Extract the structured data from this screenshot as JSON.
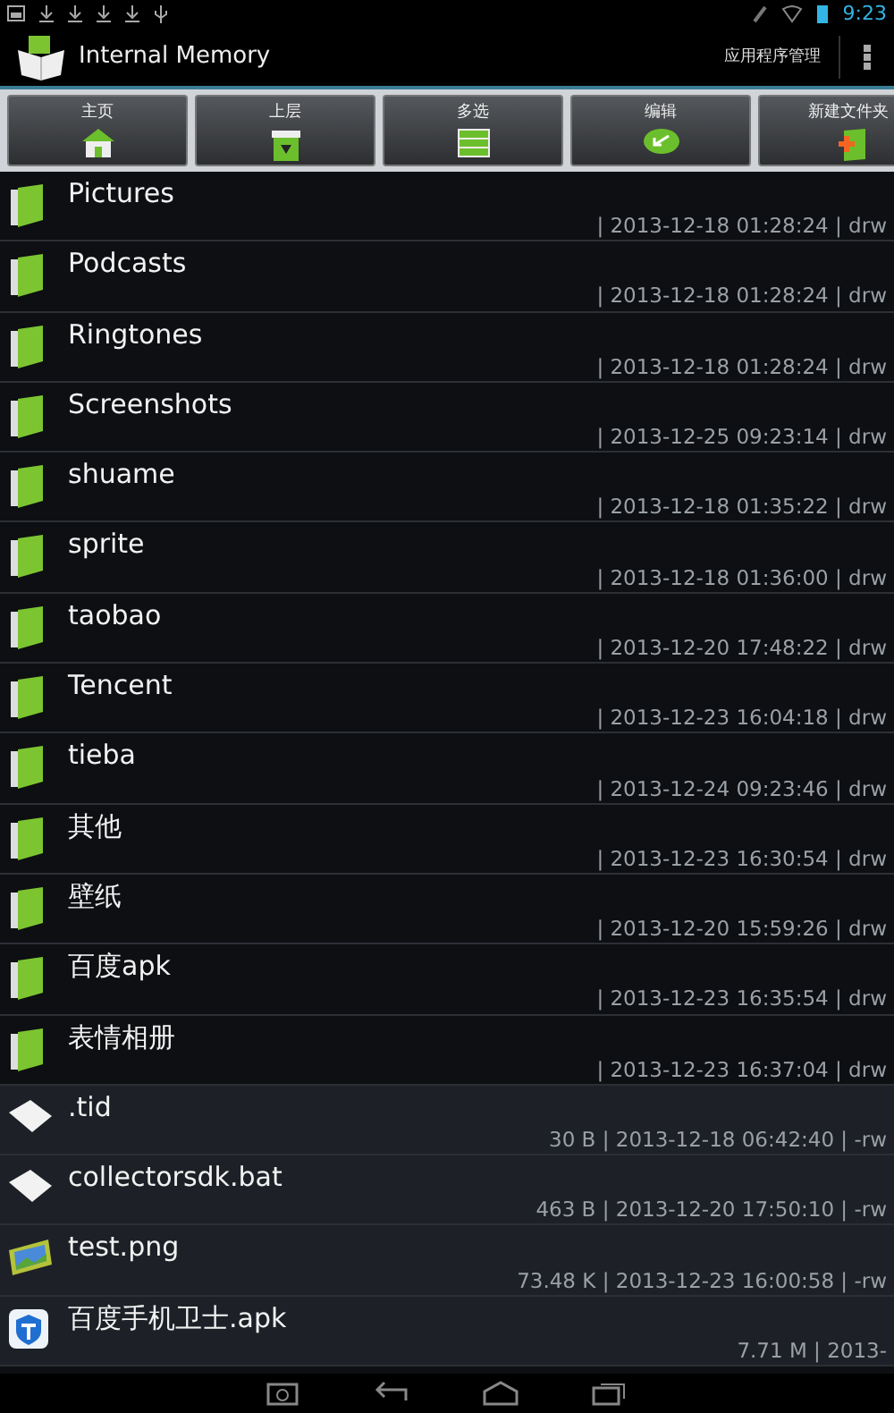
{
  "status_bar": {
    "time": "9:23"
  },
  "action_bar": {
    "title": "Internal Memory",
    "action": "应用程序管理"
  },
  "toolbar": [
    {
      "label": "主页",
      "kind": "home"
    },
    {
      "label": "上层",
      "kind": "up"
    },
    {
      "label": "多选",
      "kind": "multi"
    },
    {
      "label": "编辑",
      "kind": "edit"
    },
    {
      "label": "新建文件夹",
      "kind": "newfolder"
    }
  ],
  "files": [
    {
      "name": "Pictures",
      "meta": "| 2013-12-18 01:28:24 | drw",
      "kind": "folder"
    },
    {
      "name": "Podcasts",
      "meta": "| 2013-12-18 01:28:24 | drw",
      "kind": "folder"
    },
    {
      "name": "Ringtones",
      "meta": "| 2013-12-18 01:28:24 | drw",
      "kind": "folder"
    },
    {
      "name": "Screenshots",
      "meta": "| 2013-12-25 09:23:14 | drw",
      "kind": "folder"
    },
    {
      "name": "shuame",
      "meta": "| 2013-12-18 01:35:22 | drw",
      "kind": "folder"
    },
    {
      "name": "sprite",
      "meta": "| 2013-12-18 01:36:00 | drw",
      "kind": "folder"
    },
    {
      "name": "taobao",
      "meta": "| 2013-12-20 17:48:22 | drw",
      "kind": "folder"
    },
    {
      "name": "Tencent",
      "meta": "| 2013-12-23 16:04:18 | drw",
      "kind": "folder"
    },
    {
      "name": "tieba",
      "meta": "| 2013-12-24 09:23:46 | drw",
      "kind": "folder"
    },
    {
      "name": "其他",
      "meta": "| 2013-12-23 16:30:54 | drw",
      "kind": "folder"
    },
    {
      "name": "壁纸",
      "meta": "| 2013-12-20 15:59:26 | drw",
      "kind": "folder"
    },
    {
      "name": "百度apk",
      "meta": "| 2013-12-23 16:35:54 | drw",
      "kind": "folder"
    },
    {
      "name": "表情相册",
      "meta": "| 2013-12-23 16:37:04 | drw",
      "kind": "folder"
    },
    {
      "name": ".tid",
      "meta": "30 B | 2013-12-18 06:42:40 | -rw",
      "kind": "file"
    },
    {
      "name": "collectorsdk.bat",
      "meta": "463 B | 2013-12-20 17:50:10 | -rw",
      "kind": "file"
    },
    {
      "name": "test.png",
      "meta": "73.48 K | 2013-12-23 16:00:58 | -rw",
      "kind": "image"
    },
    {
      "name": "百度手机卫士.apk",
      "meta": "7.71 M | 2013-",
      "kind": "apk"
    }
  ]
}
